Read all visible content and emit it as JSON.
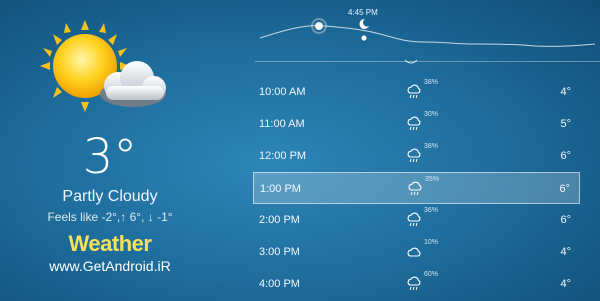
{
  "current": {
    "temperature": "3°",
    "condition": "Partly Cloudy",
    "feels_like": "Feels like -2°,↑ 6°, ↓ -1°",
    "icon": "partly-cloudy-icon"
  },
  "branding": {
    "title": "Weather",
    "website": "www.GetAndroid.iR"
  },
  "graph": {
    "time_label": "4:45 PM"
  },
  "hourly": [
    {
      "time": "10:00 AM",
      "precip": "38%",
      "temp": "4°",
      "icon": "rain-cloud-icon"
    },
    {
      "time": "11:00 AM",
      "precip": "30%",
      "temp": "5°",
      "icon": "rain-cloud-icon"
    },
    {
      "time": "12:00 PM",
      "precip": "38%",
      "temp": "6°",
      "icon": "rain-cloud-icon"
    },
    {
      "time": "1:00 PM",
      "precip": "35%",
      "temp": "6°",
      "icon": "rain-cloud-icon",
      "selected": true
    },
    {
      "time": "2:00 PM",
      "precip": "36%",
      "temp": "6°",
      "icon": "rain-cloud-icon"
    },
    {
      "time": "3:00 PM",
      "precip": "10%",
      "temp": "4°",
      "icon": "cloud-icon"
    },
    {
      "time": "4:00 PM",
      "precip": "60%",
      "temp": "4°",
      "icon": "rain-cloud-icon"
    }
  ],
  "colors": {
    "background": "#1f6f9f",
    "brand_title": "#f6e25a",
    "selected_row": "rgba(255,255,255,0.22)"
  }
}
